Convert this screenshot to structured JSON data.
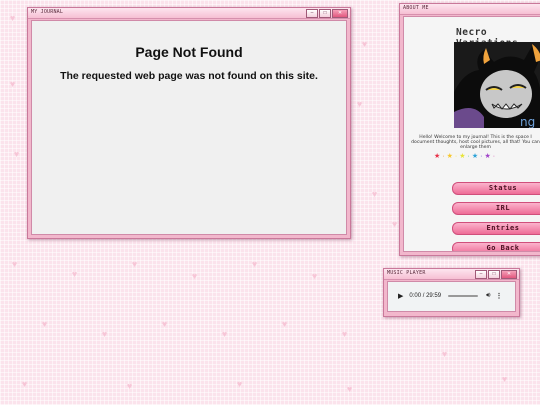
{
  "journal_window": {
    "title": "MY JOURNAL",
    "heading": "Page Not Found",
    "message": "The requested web page was not found on this site."
  },
  "about_window": {
    "title": "ABOUT ME",
    "site_name": "Necro Variations",
    "intro": "Hello! Welcome to my journal! This is the space I document thoughts, host cool pictures, all that! You can enlarge them",
    "nav": [
      {
        "label": "Status"
      },
      {
        "label": "IRL"
      },
      {
        "label": "Entries"
      },
      {
        "label": "Go Back"
      }
    ]
  },
  "music_window": {
    "title": "MUSIC PLAYER",
    "time": "0:00 / 29:59"
  },
  "colors": {
    "accent": "#f2b7cc",
    "button": "#ee6c97",
    "background": "#fbe3ec"
  },
  "icons": [
    "minimize-icon",
    "maximize-icon",
    "close-icon",
    "play-icon",
    "volume-icon",
    "more-icon"
  ]
}
